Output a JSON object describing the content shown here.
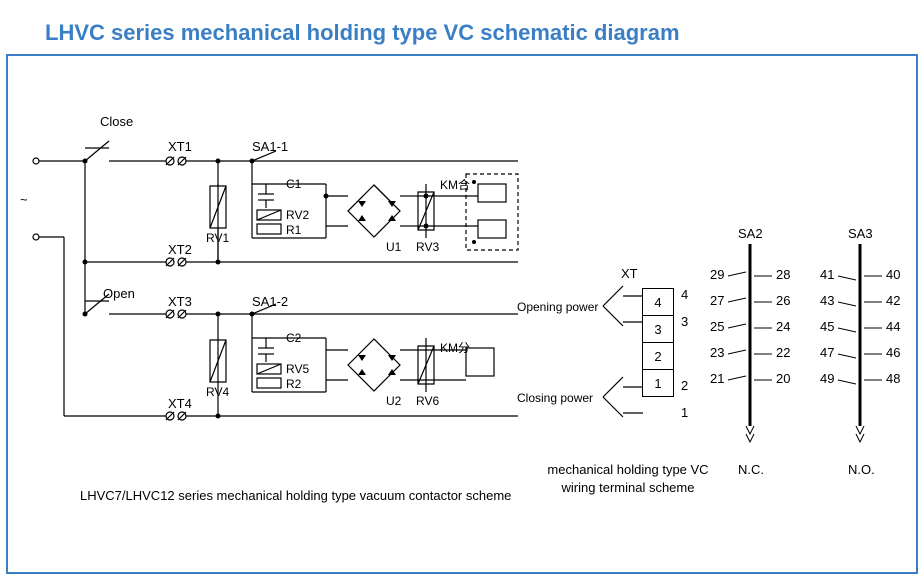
{
  "title": "LHVC series mechanical holding type VC schematic diagram",
  "labels": {
    "close": "Close",
    "open": "Open",
    "xt1": "XT1",
    "xt2": "XT2",
    "xt3": "XT3",
    "xt4": "XT4",
    "sa11": "SA1-1",
    "sa12": "SA1-2",
    "rv1": "RV1",
    "rv2": "RV2",
    "rv3": "RV3",
    "rv4": "RV4",
    "rv5": "RV5",
    "rv6": "RV6",
    "c1": "C1",
    "c2": "C2",
    "r1": "R1",
    "r2": "R2",
    "u1": "U1",
    "u2": "U2",
    "kmc": "KM合",
    "kmo": "KM分",
    "xt": "XT",
    "openpow": "Opening power",
    "closepow": "Closing power",
    "t1": "1",
    "t2": "2",
    "t3": "3",
    "t4": "4",
    "sa2": "SA2",
    "sa3": "SA3",
    "nc": "N.C.",
    "no": "N.O.",
    "sa2n": [
      "29",
      "28",
      "27",
      "26",
      "25",
      "24",
      "23",
      "22",
      "21",
      "20"
    ],
    "sa3n": [
      "41",
      "40",
      "43",
      "42",
      "45",
      "44",
      "47",
      "46",
      "49",
      "48"
    ]
  },
  "captions": {
    "left": "LHVC7/LHVC12 series mechanical holding type vacuum contactor scheme",
    "mid1": "mechanical holding type VC",
    "mid2": "wiring terminal scheme"
  }
}
